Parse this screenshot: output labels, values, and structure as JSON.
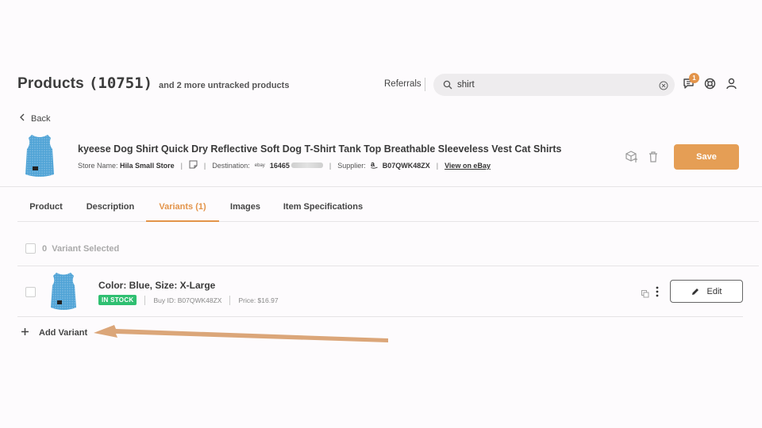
{
  "header": {
    "title": "Products",
    "count": "(10751)",
    "subtitle": "and 2 more untracked products",
    "referrals_label": "Referrals",
    "search_value": "shirt",
    "notification_count": "1"
  },
  "nav": {
    "back_label": "Back"
  },
  "product": {
    "title": "kyeese Dog Shirt Quick Dry Reflective Soft Dog T-Shirt Tank Top Breathable Sleeveless Vest Cat Shirts",
    "store_label": "Store Name:",
    "store_name": "Hila Small Store",
    "destination_label": "Destination:",
    "destination_id": "16465",
    "supplier_label": "Supplier:",
    "supplier_id": "B07QWK48ZX",
    "view_link": "View on eBay",
    "ebay_text": "ebay",
    "save_label": "Save",
    "image_color": "#4fa3d6"
  },
  "tabs": [
    {
      "label": "Product"
    },
    {
      "label": "Description"
    },
    {
      "label": "Variants (1)"
    },
    {
      "label": "Images"
    },
    {
      "label": "Item Specifications"
    }
  ],
  "variants": {
    "selected_text": "0  Variant Selected",
    "items": [
      {
        "title": "Color: Blue, Size: X-Large",
        "stock": "IN STOCK",
        "buy_id": "Buy ID: B07QWK48ZX",
        "price": "Price: $16.97",
        "edit_label": "Edit"
      }
    ],
    "add_label": "Add Variant"
  },
  "colors": {
    "accent": "#e59e55",
    "in_stock": "#2fbf71",
    "annotation_arrow": "#dba679"
  }
}
